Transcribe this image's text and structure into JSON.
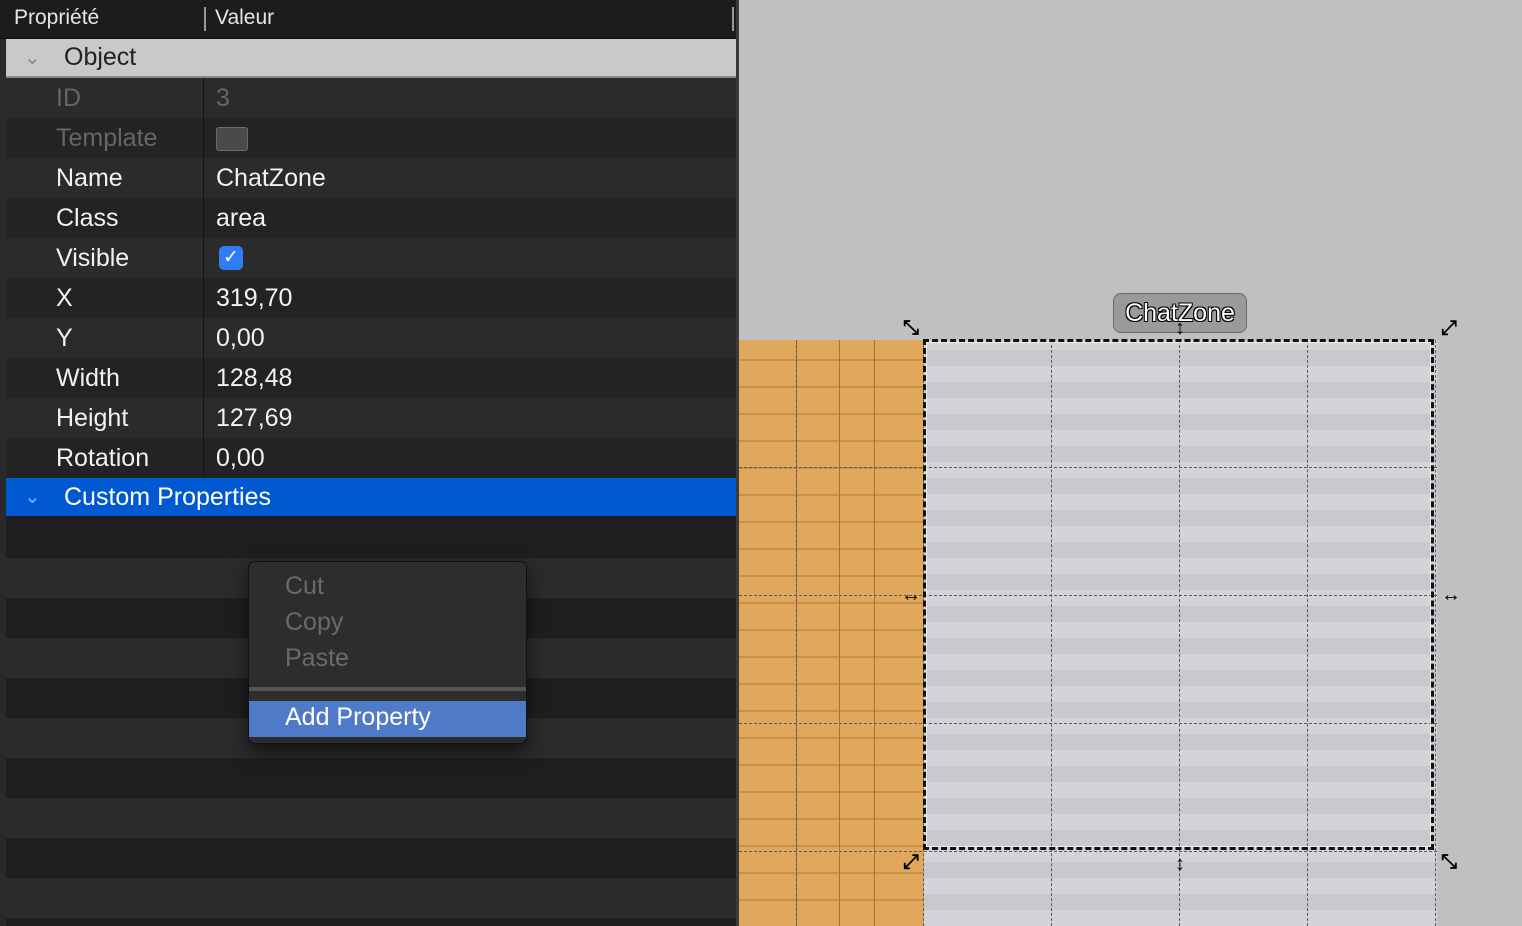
{
  "header": {
    "col1": "Propriété",
    "col2": "Valeur"
  },
  "group_object": {
    "label": "Object"
  },
  "rows": [
    {
      "key": "ID",
      "value": "3"
    },
    {
      "key": "Template",
      "value": ""
    },
    {
      "key": "Name",
      "value": "ChatZone"
    },
    {
      "key": "Class",
      "value": "area"
    },
    {
      "key": "Visible",
      "value": ""
    },
    {
      "key": "X",
      "value": "319,70"
    },
    {
      "key": "Y",
      "value": "0,00"
    },
    {
      "key": "Width",
      "value": "128,48"
    },
    {
      "key": "Height",
      "value": "127,69"
    },
    {
      "key": "Rotation",
      "value": "0,00"
    }
  ],
  "group_custom": {
    "label": "Custom Properties"
  },
  "visible_checked": true,
  "context_menu": {
    "items": [
      "Cut",
      "Copy",
      "Paste"
    ],
    "action": "Add Property"
  },
  "canvas": {
    "object_label": "ChatZone"
  },
  "colors": {
    "selection": "#0159d2",
    "menu_highlight": "#4f7ac7",
    "wood": "#e0a85c"
  },
  "icons": {
    "chevron": "chevron-down-icon",
    "check": "checkmark-icon",
    "resize": "resize-arrow-icon"
  }
}
